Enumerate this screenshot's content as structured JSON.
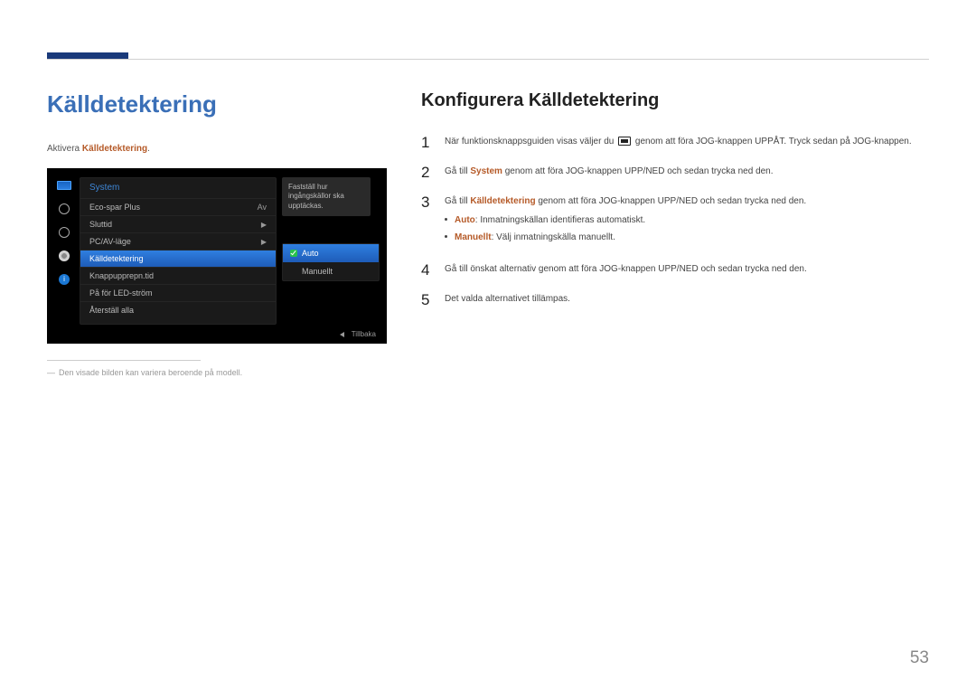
{
  "left": {
    "title": "Källdetektering",
    "activate_prefix": "Aktivera ",
    "activate_bold": "Källdetektering",
    "activate_suffix": ".",
    "footnote": "Den visade bilden kan variera beroende på modell."
  },
  "osd": {
    "section_title": "System",
    "tooltip": "Fastställ hur ingångskällor ska upptäckas.",
    "items": [
      {
        "label": "Eco-spar Plus",
        "value": "Av"
      },
      {
        "label": "Sluttid",
        "value": "▶"
      },
      {
        "label": "PC/AV-läge",
        "value": "▶"
      },
      {
        "label": "Källdetektering",
        "value": "Auto",
        "selected": true
      },
      {
        "label": "Knappupprepn.tid",
        "value": ""
      },
      {
        "label": "På för LED-ström",
        "value": ""
      },
      {
        "label": "Återställ alla",
        "value": ""
      }
    ],
    "submenu": {
      "options": [
        {
          "label": "Auto",
          "selected": true
        },
        {
          "label": "Manuellt",
          "selected": false
        }
      ]
    },
    "footer_label": "Tillbaka"
  },
  "right": {
    "title": "Konfigurera Källdetektering",
    "steps": {
      "s1a": "När funktionsknappsguiden visas väljer du ",
      "s1b": " genom att föra JOG-knappen UPPÅT. Tryck sedan på JOG-knappen.",
      "s2a": "Gå till ",
      "s2b": "System",
      "s2c": " genom att föra JOG-knappen UPP/NED och sedan trycka ned den.",
      "s3a": "Gå till ",
      "s3b": "Källdetektering",
      "s3c": " genom att föra JOG-knappen UPP/NED och sedan trycka ned den.",
      "sub_auto_b": "Auto",
      "sub_auto_t": ": Inmatningskällan identifieras automatiskt.",
      "sub_man_b": "Manuellt",
      "sub_man_t": ": Välj inmatningskälla manuellt.",
      "s4": "Gå till önskat alternativ genom att föra JOG-knappen UPP/NED och sedan trycka ned den.",
      "s5": "Det valda alternativet tillämpas."
    }
  },
  "page_number": "53"
}
